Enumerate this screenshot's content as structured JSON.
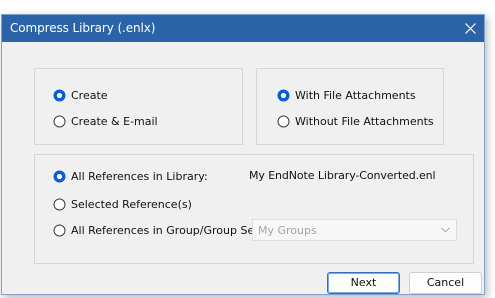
{
  "dialog": {
    "title": "Compress Library (.enlx)",
    "close_icon": "close-icon"
  },
  "mode_group": {
    "options": [
      {
        "label": "Create",
        "selected": true
      },
      {
        "label": "Create & E-mail",
        "selected": false
      }
    ]
  },
  "attachment_group": {
    "options": [
      {
        "label": "With File Attachments",
        "selected": true
      },
      {
        "label": "Without File Attachments",
        "selected": false
      }
    ]
  },
  "reference_group": {
    "options": [
      {
        "label": "All References in Library:",
        "selected": true
      },
      {
        "label": "Selected Reference(s)",
        "selected": false
      },
      {
        "label": "All References in Group/Group Set:",
        "selected": false
      }
    ],
    "library_name": "My EndNote Library-Converted.enl",
    "group_select": {
      "value": "My Groups",
      "enabled": false,
      "icon": "chevron-down-icon"
    }
  },
  "buttons": {
    "next": "Next",
    "cancel": "Cancel"
  },
  "colors": {
    "title_bar": "#2b63a8",
    "radio_selected": "#0b5cd5",
    "dialog_background": "#f0f0f0"
  }
}
